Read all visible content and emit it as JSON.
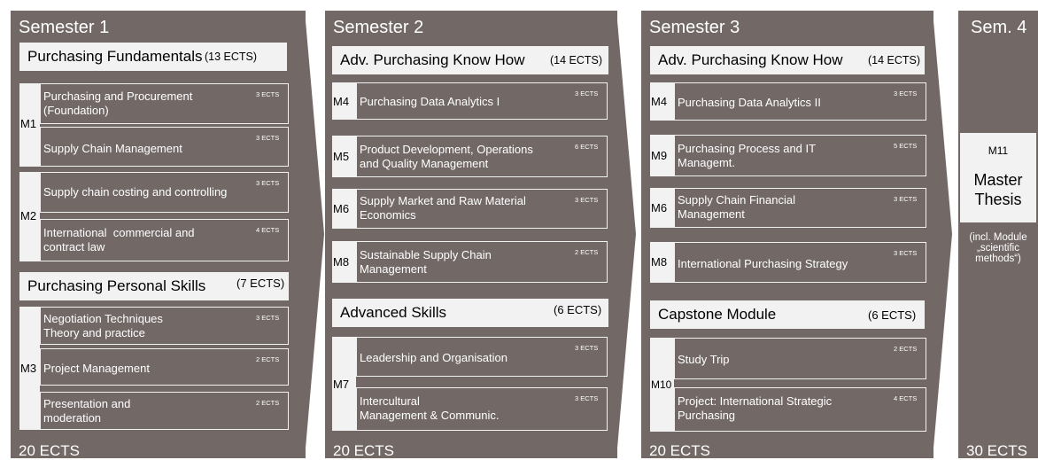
{
  "semesters": [
    {
      "title": "Semester 1",
      "ects": "20 ECTS",
      "groups": [
        {
          "name": "Purchasing  Fundamentals",
          "ects": "(13 ECTS)"
        },
        {
          "name": "Purchasing  Personal Skills",
          "ects": "(7 ECTS)"
        }
      ],
      "labels": [
        "M1",
        "M2",
        "M3"
      ],
      "courses": [
        {
          "title": "Purchasing and Procurement\n(Foundation)",
          "ects": "3 ECTS"
        },
        {
          "title": "Supply Chain Management",
          "ects": "3 ECTS"
        },
        {
          "title": "Supply chain costing and controlling",
          "ects": "3 ECTS"
        },
        {
          "title": "International  commercial and\ncontract law",
          "ects": "4 ECTS"
        },
        {
          "title": "Negotiation Techniques\nTheory and practice",
          "ects": "3 ECTS"
        },
        {
          "title": "Project Management",
          "ects": "2 ECTS"
        },
        {
          "title": "Presentation and\nmoderation",
          "ects": "2 ECTS"
        }
      ]
    },
    {
      "title": "Semester 2",
      "ects": "20 ECTS",
      "groups": [
        {
          "name": "Adv. Purchasing Know How",
          "ects": "(14 ECTS)"
        },
        {
          "name": "Advanced Skills",
          "ects": "(6 ECTS)"
        }
      ],
      "courses": [
        {
          "label": "M4",
          "title": "Purchasing Data Analytics I",
          "ects": "3 ECTS"
        },
        {
          "label": "M5",
          "title": "Product Development, Operations\nand Quality Management",
          "ects": "6 ECTS"
        },
        {
          "label": "M6",
          "title": "Supply Market and Raw Material\nEconomics",
          "ects": "3 ECTS"
        },
        {
          "label": "M8",
          "title": "Sustainable Supply Chain\nManagement",
          "ects": "2 ECTS"
        },
        {
          "title": "Leadership and Organisation",
          "ects": "3 ECTS"
        },
        {
          "title": "Intercultural\nManagement & Communic.",
          "ects": "3 ECTS"
        }
      ],
      "labels": [
        "M7"
      ]
    },
    {
      "title": "Semester 3",
      "ects": "20 ECTS",
      "groups": [
        {
          "name": "Adv. Purchasing Know How",
          "ects": "(14 ECTS)"
        },
        {
          "name": "Capstone Module",
          "ects": "(6 ECTS)"
        }
      ],
      "courses": [
        {
          "label": "M4",
          "title": "Purchasing Data Analytics II",
          "ects": "3 ECTS"
        },
        {
          "label": "M9",
          "title": "Purchasing Process and IT\nManagemt.",
          "ects": "5 ECTS"
        },
        {
          "label": "M6",
          "title": "Supply Chain Financial\nManagement",
          "ects": "3 ECTS"
        },
        {
          "label": "M8",
          "title": "International Purchasing Strategy",
          "ects": "3 ECTS"
        },
        {
          "title": "Study Trip",
          "ects": "2 ECTS"
        },
        {
          "title": "Project: International Strategic\nPurchasing",
          "ects": "4 ECTS"
        }
      ],
      "labels": [
        "M10"
      ]
    },
    {
      "title": "Sem. 4",
      "ects": "30 ECTS",
      "thesis": {
        "label": "M11",
        "title": "Master\nThesis",
        "note": "(incl. Module\n„scientific\nmethods“)"
      }
    }
  ]
}
